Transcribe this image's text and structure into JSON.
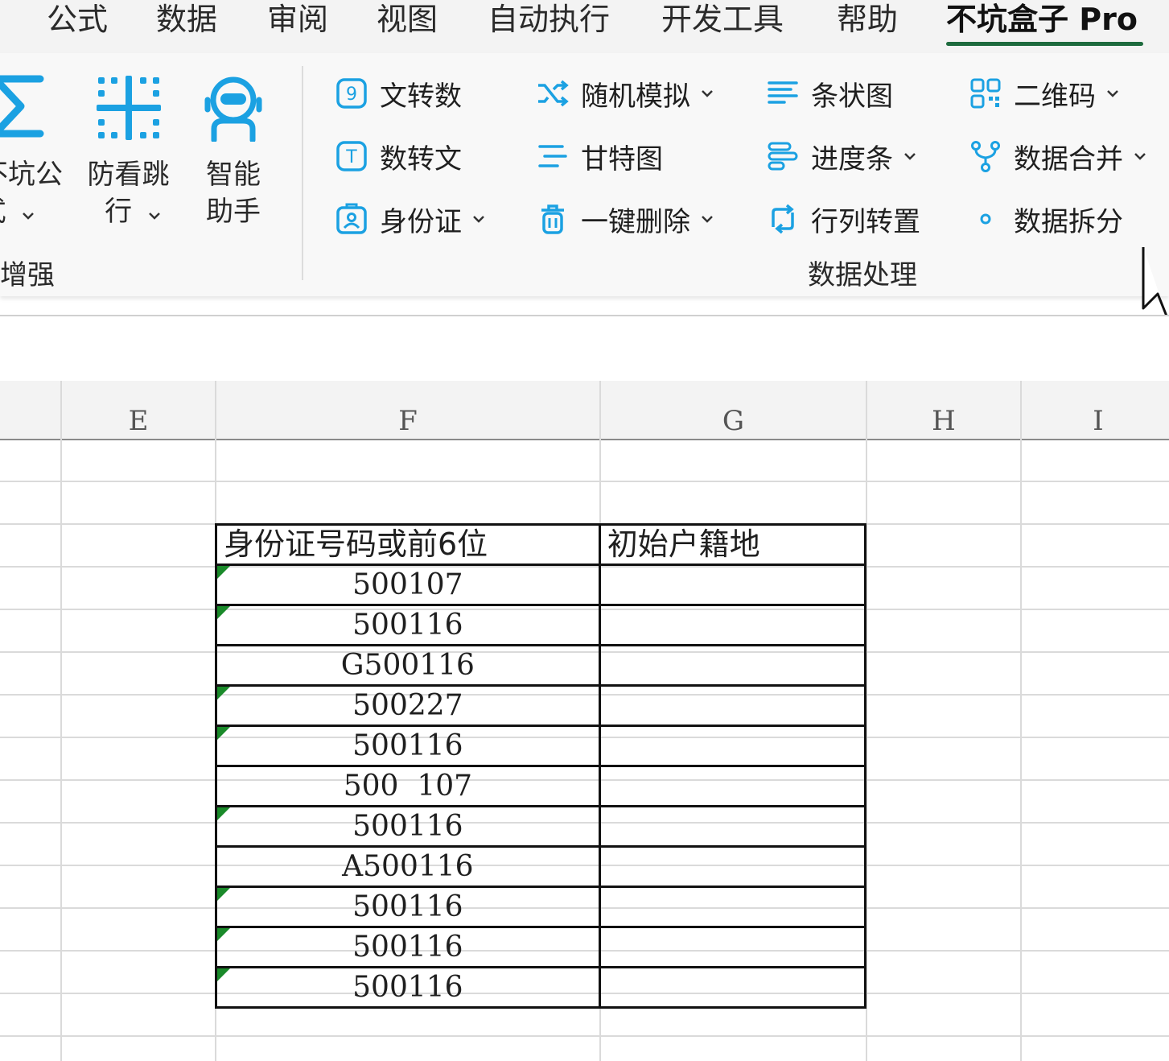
{
  "menu": {
    "tabs": [
      "公式",
      "数据",
      "审阅",
      "视图",
      "自动执行",
      "开发工具",
      "帮助",
      "不坑盒子 Pro"
    ],
    "active_tab": "不坑盒子 Pro"
  },
  "ribbon": {
    "enhance_group": {
      "label": "增强",
      "buttons": [
        {
          "label_line1": "不坑公",
          "label_line2": "式",
          "icon": "sigma-icon"
        },
        {
          "label_line1": "防看跳",
          "label_line2": "行",
          "icon": "grid-crosshair-icon"
        },
        {
          "label_line1": "智能",
          "label_line2": "助手",
          "icon": "robot-icon"
        }
      ]
    },
    "data_group": {
      "label": "数据处理",
      "buttons": [
        {
          "label": "文转数",
          "icon": "text-to-number-icon",
          "dropdown": false
        },
        {
          "label": "随机模拟",
          "icon": "shuffle-icon",
          "dropdown": true
        },
        {
          "label": "条状图",
          "icon": "bar-lines-icon",
          "dropdown": false
        },
        {
          "label": "二维码",
          "icon": "qr-code-icon",
          "dropdown": true
        },
        {
          "label": "数转文",
          "icon": "number-to-text-icon",
          "dropdown": false
        },
        {
          "label": "甘特图",
          "icon": "gantt-icon",
          "dropdown": false
        },
        {
          "label": "进度条",
          "icon": "progress-bar-icon",
          "dropdown": true
        },
        {
          "label": "数据合并",
          "icon": "merge-icon",
          "dropdown": true
        },
        {
          "label": "身份证",
          "icon": "id-card-icon",
          "dropdown": true
        },
        {
          "label": "一键删除",
          "icon": "trash-icon",
          "dropdown": true
        },
        {
          "label": "行列转置",
          "icon": "transpose-icon",
          "dropdown": false
        },
        {
          "label": "数据拆分",
          "icon": "split-icon",
          "dropdown": false
        }
      ]
    }
  },
  "sheet": {
    "columns": [
      "E",
      "F",
      "G",
      "H",
      "I"
    ],
    "table": {
      "headers": [
        "身份证号码或前6位",
        "初始户籍地"
      ],
      "rows": [
        {
          "value": "500107",
          "text_flag": true
        },
        {
          "value": "500116",
          "text_flag": true
        },
        {
          "value": "G500116",
          "text_flag": false
        },
        {
          "value": "500227",
          "text_flag": true
        },
        {
          "value": "500116",
          "text_flag": true
        },
        {
          "value": "500  107",
          "text_flag": false
        },
        {
          "value": "500116",
          "text_flag": true
        },
        {
          "value": "A500116",
          "text_flag": false
        },
        {
          "value": "500116",
          "text_flag": true
        },
        {
          "value": "500116",
          "text_flag": true
        },
        {
          "value": "500116",
          "text_flag": true
        }
      ]
    }
  },
  "colors": {
    "accent_blue": "#1ba1e2",
    "active_tab_underline": "#1e6b3e",
    "text_flag_green": "#1a8a2a"
  }
}
